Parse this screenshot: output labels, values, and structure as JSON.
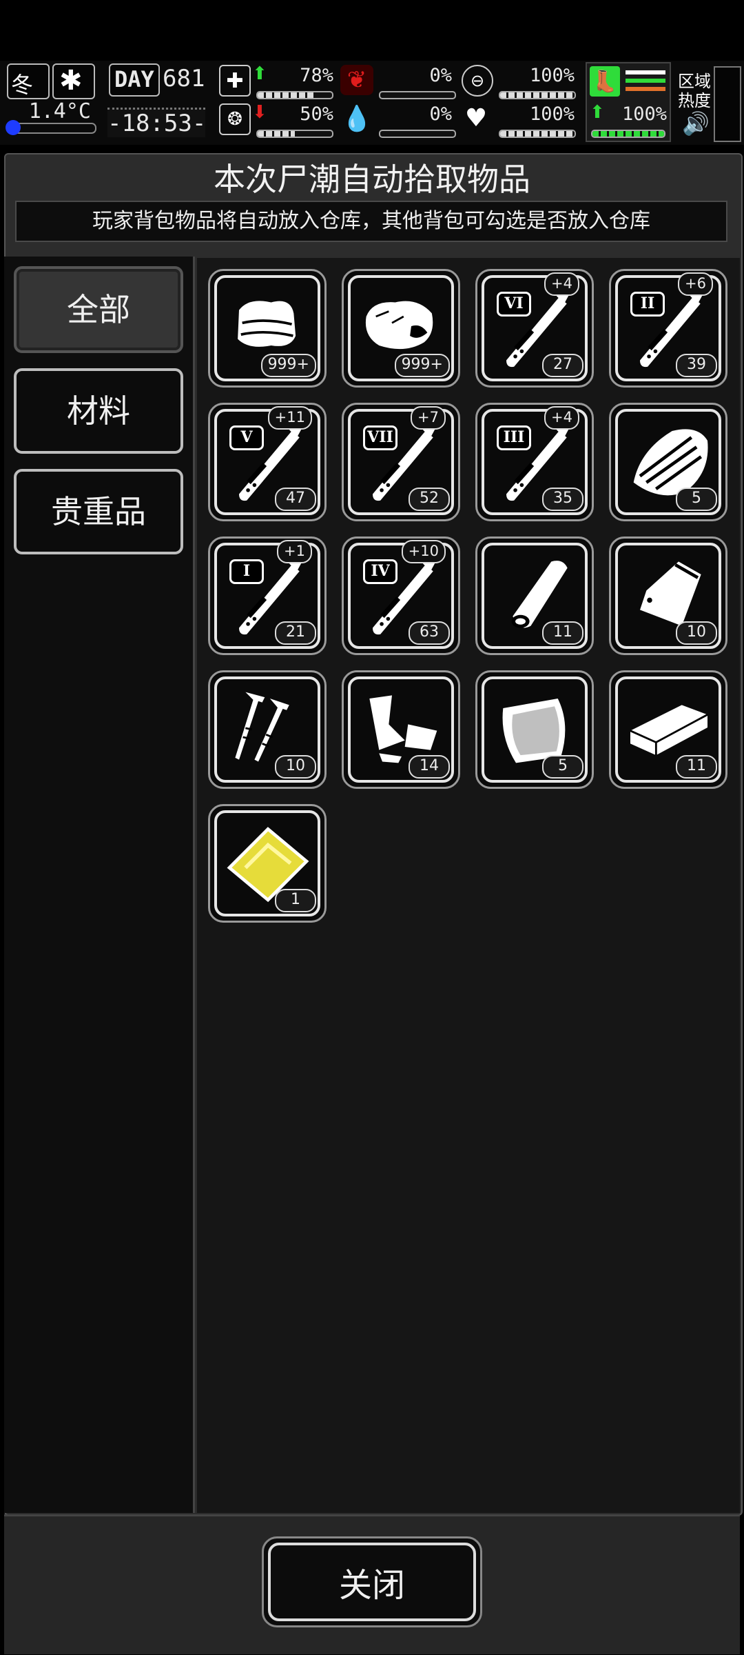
{
  "hud": {
    "season": "冬",
    "temperature": "1.4°C",
    "day_label": "DAY",
    "day_value": "681",
    "time": "-18:53-",
    "health_pct": "78%",
    "hunger_pct": "0%",
    "protection_pct": "100%",
    "mood_pct": "50%",
    "bleed_pct": "0%",
    "heart_pct": "100%",
    "stamina_pct": "100%",
    "zone_heat_label": "区域\n热度",
    "status_up_color": "#2fdc3a",
    "status_down_color": "#e02020",
    "stomach_color": "#d81c1c",
    "stamina_color": "#2fdc3a"
  },
  "dialog": {
    "title": "本次尸潮自动拾取物品",
    "subtitle": "玩家背包物品将自动放入仓库，其他背包可勾选是否放入仓库"
  },
  "tabs": [
    {
      "label": "全部",
      "active": true
    },
    {
      "label": "材料",
      "active": false
    },
    {
      "label": "贵重品",
      "active": false
    }
  ],
  "items": [
    {
      "icon": "cloth-icon",
      "count": "999+"
    },
    {
      "icon": "raw-meat-icon",
      "count": "999+"
    },
    {
      "icon": "syringe-icon",
      "tier": "VI",
      "plus": "+4",
      "count": "27"
    },
    {
      "icon": "syringe-icon",
      "tier": "II",
      "plus": "+6",
      "count": "39"
    },
    {
      "icon": "syringe-icon",
      "tier": "V",
      "plus": "+11",
      "count": "47"
    },
    {
      "icon": "syringe-icon",
      "tier": "VII",
      "plus": "+7",
      "count": "52"
    },
    {
      "icon": "syringe-icon",
      "tier": "III",
      "plus": "+4",
      "count": "35"
    },
    {
      "icon": "bark-icon",
      "count": "5"
    },
    {
      "icon": "syringe-icon",
      "tier": "I",
      "plus": "+1",
      "count": "21"
    },
    {
      "icon": "syringe-icon",
      "tier": "IV",
      "plus": "+10",
      "count": "63"
    },
    {
      "icon": "log-icon",
      "count": "11"
    },
    {
      "icon": "plastic-bag-icon",
      "count": "10"
    },
    {
      "icon": "nails-icon",
      "count": "10"
    },
    {
      "icon": "scrap-metal-icon",
      "count": "14"
    },
    {
      "icon": "glass-sheet-icon",
      "count": "5"
    },
    {
      "icon": "plank-icon",
      "count": "11"
    },
    {
      "icon": "gold-card-icon",
      "count": "1"
    }
  ],
  "close_label": "关闭"
}
